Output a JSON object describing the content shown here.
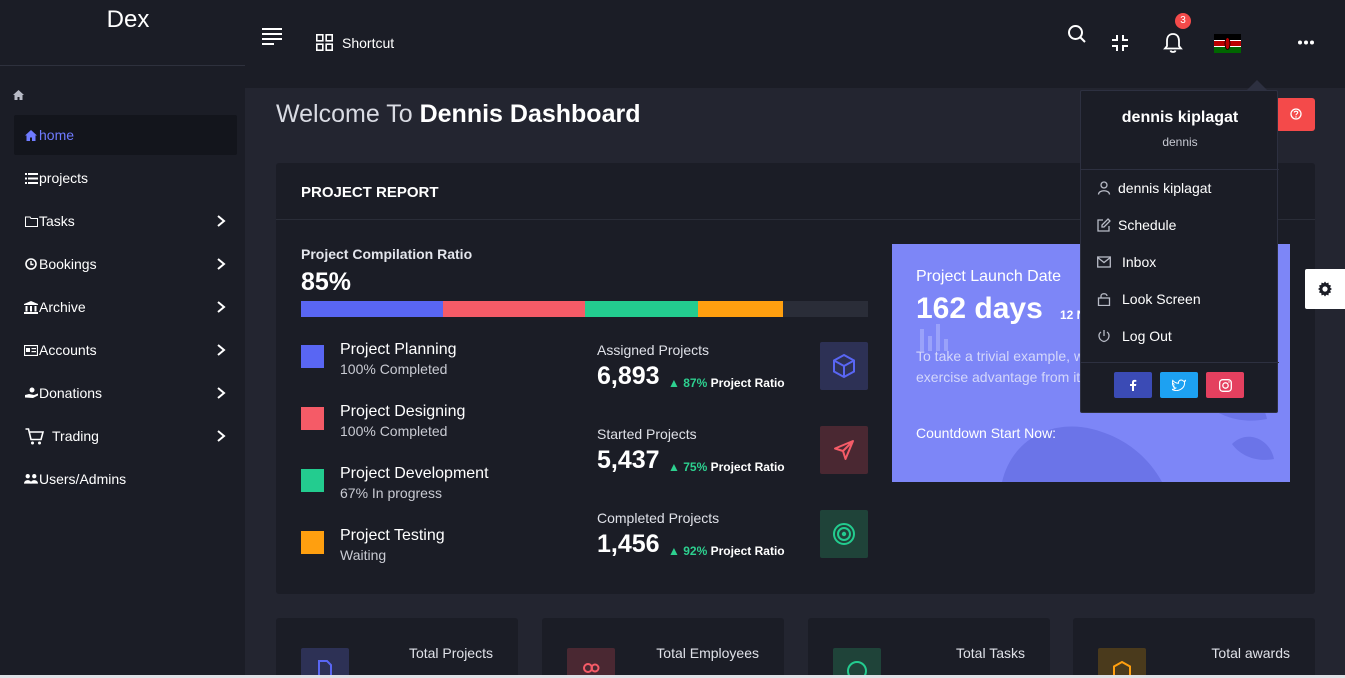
{
  "app": {
    "logo": "Dex"
  },
  "sidebar": {
    "items": [
      {
        "label": "home",
        "icon": "home-icon",
        "active": true
      },
      {
        "label": "projects",
        "icon": "list-icon"
      },
      {
        "label": "Tasks",
        "icon": "folder-icon"
      },
      {
        "label": "Bookings",
        "icon": "clock-icon"
      },
      {
        "label": "Archive",
        "icon": "bank-icon"
      },
      {
        "label": "Accounts",
        "icon": "id-card-icon"
      },
      {
        "label": "Donations",
        "icon": "hand-holding-icon"
      },
      {
        "label": "Trading",
        "icon": "cart-icon"
      },
      {
        "label": "Users/Admins",
        "icon": "users-icon"
      }
    ]
  },
  "topbar": {
    "shortcut_label": "Shortcut",
    "notification_count": "3"
  },
  "welcome": {
    "prefix": "Welcome To",
    "name": "Dennis Dashboard"
  },
  "report": {
    "title": "PROJECT REPORT",
    "ratio_label": "Project Compilation Ratio",
    "ratio_value": "85%",
    "progress_segments": [
      {
        "color": "#5966f3",
        "fraction": 0.25
      },
      {
        "color": "#f55b67",
        "fraction": 0.25
      },
      {
        "color": "#23cc8f",
        "fraction": 0.2
      },
      {
        "color": "#ff9f0f",
        "fraction": 0.15
      }
    ],
    "legend": [
      {
        "name": "Project Planning",
        "status": "100% Completed",
        "color": "#5966f3"
      },
      {
        "name": "Project Designing",
        "status": "100% Completed",
        "color": "#f55b67"
      },
      {
        "name": "Project Development",
        "status": "67% In progress",
        "color": "#23cc8f"
      },
      {
        "name": "Project Testing",
        "status": "Waiting",
        "color": "#ff9f0f"
      }
    ],
    "stats": [
      {
        "label": "Assigned Projects",
        "value": "6,893",
        "pct": "87%",
        "suffix": "Project Ratio",
        "icon": "cube-icon"
      },
      {
        "label": "Started Projects",
        "value": "5,437",
        "pct": "75%",
        "suffix": "Project Ratio",
        "icon": "send-icon"
      },
      {
        "label": "Completed Projects",
        "value": "1,456",
        "pct": "92%",
        "suffix": "Project Ratio",
        "icon": "target-icon"
      }
    ]
  },
  "launch": {
    "title": "Project Launch Date",
    "days": "162 days",
    "date_partial": "12 N",
    "text": "To take a trivial example, w laborious physical exercise advantage from it take a tr",
    "countdown": "Countdown Start Now:"
  },
  "profile_menu": {
    "name": "dennis kiplagat",
    "username": "dennis",
    "items": [
      {
        "label": "dennis kiplagat",
        "icon": "user-icon"
      },
      {
        "label": "Schedule",
        "icon": "edit-icon"
      },
      {
        "label": "Inbox",
        "icon": "mail-icon"
      },
      {
        "label": "Look Screen",
        "icon": "lock-icon"
      },
      {
        "label": "Log Out",
        "icon": "power-icon"
      }
    ],
    "social": [
      {
        "name": "facebook-icon",
        "color": "#3b4bb5"
      },
      {
        "name": "twitter-icon",
        "color": "#1da1f2"
      },
      {
        "name": "instagram-icon",
        "color": "#e4405f"
      }
    ]
  },
  "cards": [
    {
      "label": "Total Projects"
    },
    {
      "label": "Total Employees"
    },
    {
      "label": "Total Tasks"
    },
    {
      "label": "Total awards"
    }
  ]
}
